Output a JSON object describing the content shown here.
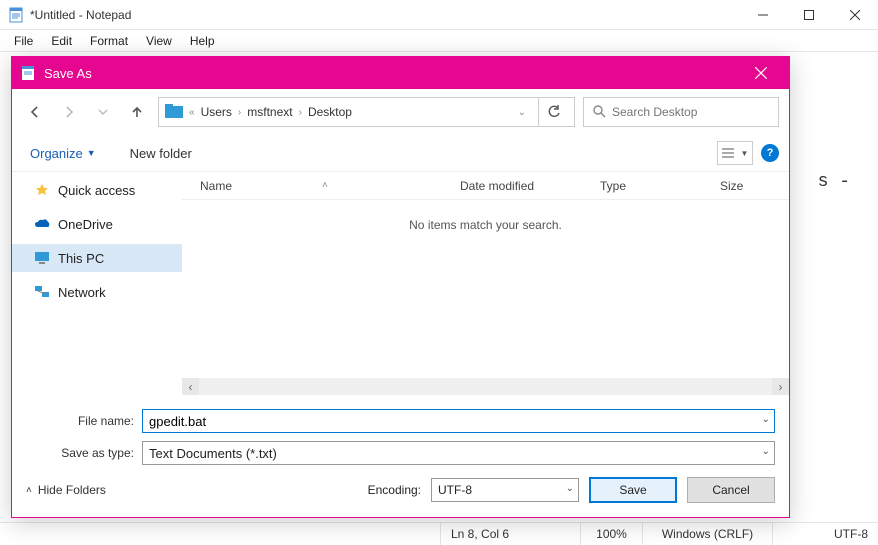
{
  "window": {
    "title": "*Untitled - Notepad"
  },
  "menu": {
    "file": "File",
    "edit": "Edit",
    "format": "Format",
    "view": "View",
    "help": "Help"
  },
  "status": {
    "lncol": "Ln 8, Col 6",
    "zoom": "100%",
    "eol": "Windows (CRLF)",
    "enc": "UTF-8"
  },
  "bg_text": "s -",
  "dialog": {
    "title": "Save As",
    "breadcrumb": {
      "root": "Users",
      "mid": "msftnext",
      "leaf": "Desktop"
    },
    "search_placeholder": "Search Desktop",
    "toolbar": {
      "organize": "Organize",
      "newfolder": "New folder"
    },
    "sidebar": {
      "quick": "Quick access",
      "onedrive": "OneDrive",
      "thispc": "This PC",
      "network": "Network"
    },
    "columns": {
      "name": "Name",
      "date": "Date modified",
      "type": "Type",
      "size": "Size"
    },
    "empty": "No items match your search.",
    "filename_label": "File name:",
    "filename": "gpedit.bat",
    "savetype_label": "Save as type:",
    "savetype": "Text Documents (*.txt)",
    "hide_folders": "Hide Folders",
    "encoding_label": "Encoding:",
    "encoding": "UTF-8",
    "save": "Save",
    "cancel": "Cancel"
  }
}
